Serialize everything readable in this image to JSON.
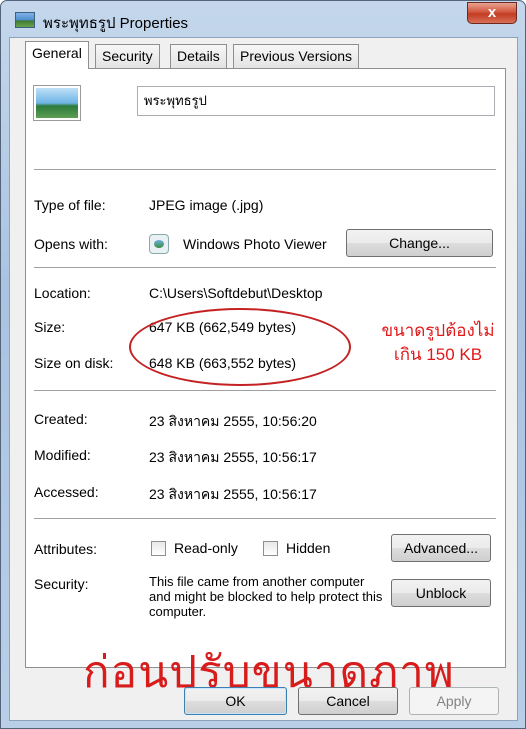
{
  "window": {
    "title": "พระพุทธรูป Properties",
    "close_glyph": "x"
  },
  "tabs": [
    {
      "label": "General",
      "active": true
    },
    {
      "label": "Security",
      "active": false
    },
    {
      "label": "Details",
      "active": false
    },
    {
      "label": "Previous Versions",
      "active": false
    }
  ],
  "file": {
    "name": "พระพุทธรูป"
  },
  "type_of_file": {
    "label": "Type of file:",
    "value": "JPEG image (.jpg)"
  },
  "opens_with": {
    "label": "Opens with:",
    "value": "Windows Photo Viewer",
    "button": "Change..."
  },
  "location": {
    "label": "Location:",
    "value": "C:\\Users\\Softdebut\\Desktop"
  },
  "size": {
    "label": "Size:",
    "value": "647 KB (662,549 bytes)"
  },
  "size_on_disk": {
    "label": "Size on disk:",
    "value": "648 KB (663,552 bytes)"
  },
  "created": {
    "label": "Created:",
    "value": "23 สิงหาคม 2555, 10:56:20"
  },
  "modified": {
    "label": "Modified:",
    "value": "23 สิงหาคม 2555, 10:56:17"
  },
  "accessed": {
    "label": "Accessed:",
    "value": "23 สิงหาคม 2555, 10:56:17"
  },
  "attributes": {
    "label": "Attributes:",
    "readonly_label": "Read-only",
    "readonly_checked": false,
    "hidden_label": "Hidden",
    "hidden_checked": false,
    "advanced_button": "Advanced..."
  },
  "security": {
    "label": "Security:",
    "text": "This file came from another computer and might be blocked to help protect this computer.",
    "unblock_button": "Unblock"
  },
  "annotations": {
    "note_line1": "ขนาดรูปต้องไม่",
    "note_line2": "เกิน 150 KB",
    "caption": "ก่อนปรับขนาดภาพ"
  },
  "footer": {
    "ok": "OK",
    "cancel": "Cancel",
    "apply": "Apply"
  },
  "colors": {
    "annotation_red": "#d81b1b",
    "titlebar": "#b9cfe8"
  }
}
